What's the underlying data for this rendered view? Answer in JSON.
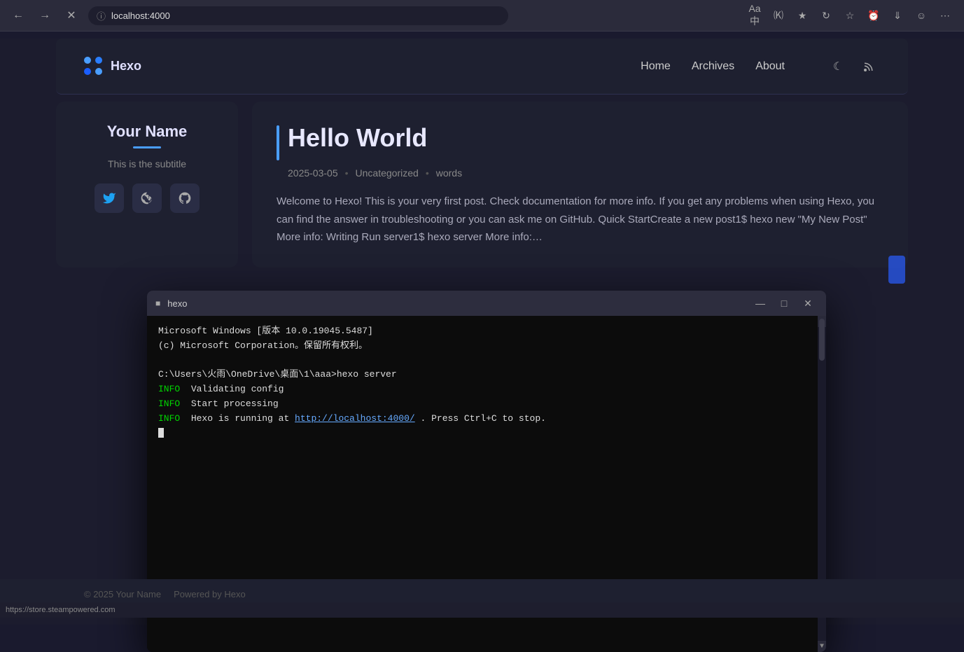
{
  "browser": {
    "url": "localhost:4000",
    "back_tooltip": "Back",
    "forward_tooltip": "Forward",
    "close_tooltip": "Close tab",
    "info_icon": "ℹ",
    "actions": [
      "⇌",
      "✩",
      "↶",
      "★",
      "⏱",
      "↓",
      "☺",
      "⋯"
    ]
  },
  "nav": {
    "logo_text": "Hexo",
    "links": [
      {
        "label": "Home",
        "href": "/"
      },
      {
        "label": "Archives",
        "href": "/archives"
      },
      {
        "label": "About",
        "href": "/about"
      }
    ],
    "dark_mode_icon": "🌙",
    "rss_icon": "📶"
  },
  "sidebar": {
    "name": "Your Name",
    "subtitle": "This is the subtitle",
    "social": [
      {
        "icon": "🐦",
        "label": "Twitter",
        "name": "twitter-button"
      },
      {
        "icon": "🎮",
        "label": "Steam",
        "name": "steam-button"
      },
      {
        "icon": "🐙",
        "label": "GitHub",
        "name": "github-button"
      }
    ]
  },
  "post": {
    "title": "Hello World",
    "date": "2025-03-05",
    "category": "Uncategorized",
    "read_label": "words",
    "excerpt": "Welcome to Hexo! This is your very first post. Check documentation for more info. If you get any problems when using Hexo, you can find the answer in troubleshooting or you can ask me on GitHub. Quick StartCreate a new post1$ hexo new \"My New Post\" More info: Writing Run server1$ hexo server More info:…"
  },
  "terminal": {
    "title": "hexo",
    "title_icon": "▪",
    "content_line1": "Microsoft Windows [版本 10.0.19045.5487]",
    "content_line2": "(c) Microsoft Corporation。保留所有权利。",
    "content_line3": "",
    "content_line4": "C:\\Users\\火雨\\OneDrive\\桌面\\1\\aaa>hexo server",
    "content_line5": "  Validating config",
    "content_line6": "  Start processing",
    "content_line7": "  Hexo is running at ",
    "content_link": "http://localhost:4000/",
    "content_line7b": " . Press Ctrl+C to stop.",
    "win_btns": [
      "—",
      "□",
      "✕"
    ]
  },
  "footer": {
    "copyright": "© 2025 Your Name",
    "powered_by": "Powered by Hexo"
  },
  "status_bar": {
    "url": "https://store.steampowered.com"
  }
}
